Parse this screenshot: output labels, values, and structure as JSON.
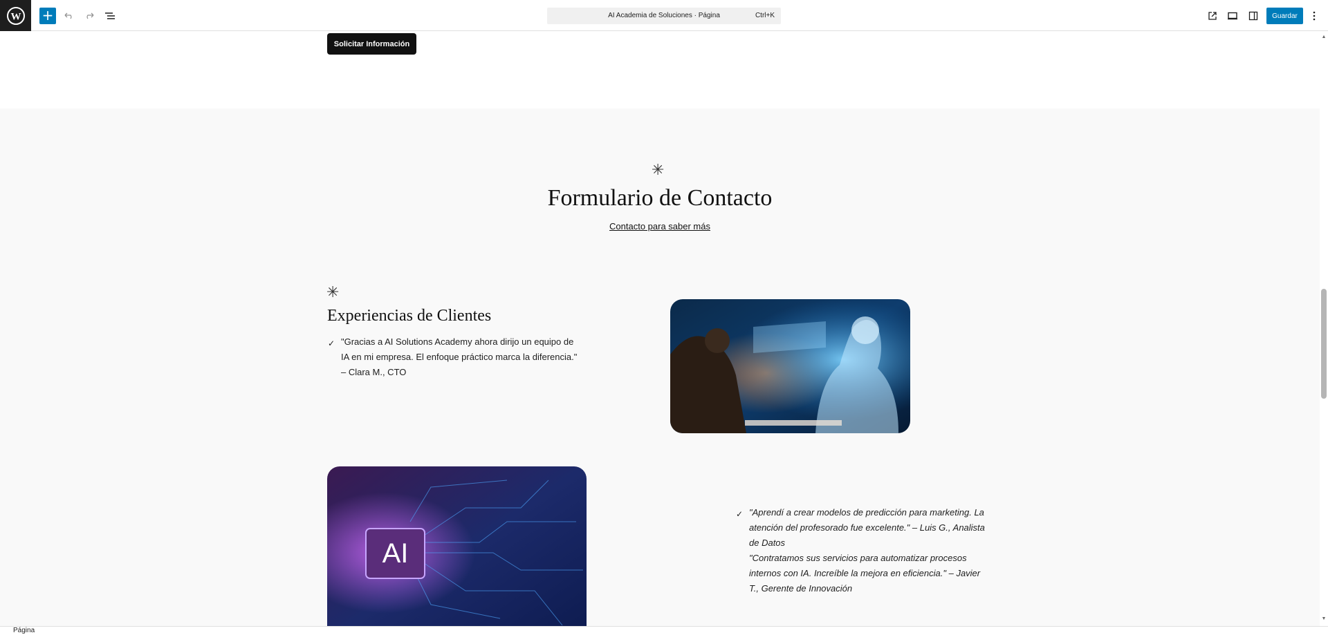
{
  "toolbar": {
    "document_title": "AI Academia de Soluciones · Página",
    "shortcut": "Ctrl+K",
    "save_label": "Guardar",
    "add_symbol": "+",
    "icons": [
      "wordpress-logo",
      "plus-icon",
      "undo-icon",
      "redo-icon",
      "list-view-icon",
      "external-link-icon",
      "device-preview-icon",
      "sidebar-toggle-icon",
      "more-options-icon"
    ]
  },
  "hero": {
    "cta_label": "Solicitar Información"
  },
  "contact": {
    "asterisk": "✳",
    "title": "Formulario de Contacto",
    "link": "Contacto para saber más"
  },
  "experiences": {
    "asterisk": "✳",
    "title": "Experiencias de Clientes",
    "check": "✓",
    "quote1_lines": [
      "\"Gracias a AI Solutions Academy ahora dirijo un equipo de",
      "IA en mi empresa. El enfoque práctico marca la diferencia.\"",
      "– Clara M., CTO"
    ],
    "quote2_lines": [
      "\"Aprendí a crear modelos de predicción para marketing. La",
      "atención del profesorado fue excelente.\" – Luis G., Analista",
      "de Datos",
      "\"Contratamos sus servicios para automatizar procesos",
      "internos con IA. Increíble la mejora en eficiencia.\" – Javier",
      "T., Gerente de Innovación"
    ],
    "ai_chip_text": "AI"
  },
  "statusbar": {
    "label": "Página"
  },
  "colors": {
    "accent": "#007cba",
    "dark": "#1e1e1e",
    "section_bg": "#f9f9f9"
  }
}
